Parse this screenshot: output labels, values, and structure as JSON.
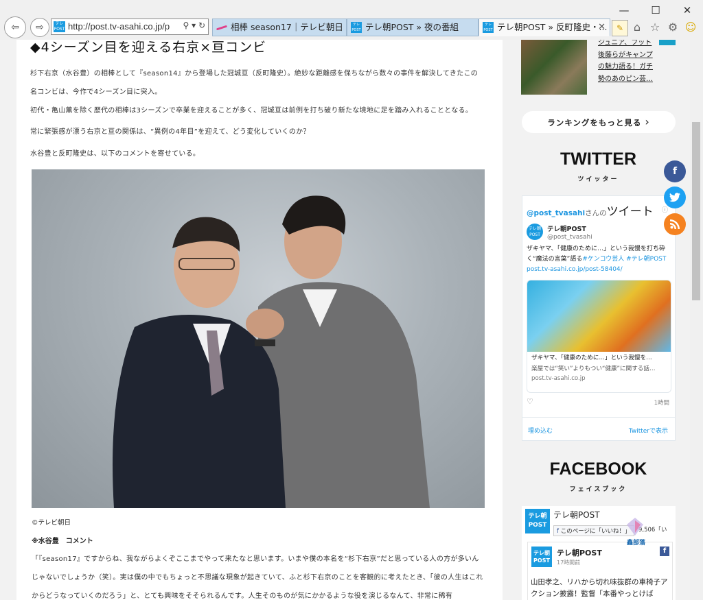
{
  "browser": {
    "url": "http://post.tv-asahi.co.jp/p",
    "favicon_text": "テレ朝POST",
    "tabs": [
      {
        "label": "相棒 season17｜テレビ朝日"
      },
      {
        "label": "テレ朝POST » 夜の番組"
      },
      {
        "label": "テレ朝POST » 反町隆史・..."
      }
    ],
    "window_controls": {
      "minimize": "—",
      "maximize": "☐",
      "close": "✕"
    }
  },
  "article": {
    "heading": "◆4シーズン目を迎える右京×亘コンビ",
    "paragraphs": [
      "杉下右京（水谷豊）の相棒として『season14』から登場した冠城亘（反町隆史）。絶妙な距離感を保ちながら数々の事件を解決してきたこの名コンビは、今作で4シーズン目に突入。",
      "初代・亀山薫を除く歴代の相棒は3シーズンで卒業を迎えることが多く、冠城亘は前例を打ち破り新たな境地に足を踏み入れることとなる。",
      "常に緊張感が漂う右京と亘の関係は、“異例の4年目”を迎えて、どう変化していくのか？",
      "水谷豊と反町隆史は、以下のコメントを寄せている。"
    ],
    "photo_caption": "©テレビ朝日",
    "comment_head": "※水谷豊　コメント",
    "comment_body": "「『season17』ですからね、我ながらよくぞここまでやって来たなと思います。いまや僕の本名を“杉下右京”だと思っている人の方が多いんじゃないでしょうか（笑）。実は僕の中でもちょっと不思議な現象が起きていて、ふと杉下右京のことを客観的に考えたとき、「彼の人生はこれからどうなっていくのだろう」と、とても興味をそそられるんです。人生そのものが気にかかるような役を演じるなんて、非常に稀有"
  },
  "sidebar": {
    "ranking_text_lines": [
      "ジュニア、フット",
      "後藤らがキャンプ",
      "の魅力語る！ガチ",
      "勢のあのピン芸…"
    ],
    "more_ranking": "ランキングをもっと見る",
    "twitter_title": "TWITTER",
    "twitter_sub": "ツイッター",
    "twitter_handle_head": "@post_tvasahi",
    "twitter_head_suffix": "さんの",
    "twitter_head_big": "ツイート",
    "tweet": {
      "name": "テレ朝POST",
      "handle": "@post_tvasahi",
      "text": "ザキヤマ、「健康のために…」という我慢を打ち砕く“魔法の言葉”語る",
      "hashtags": "#ケンコウ芸人 #テレ朝POST",
      "link": "post.tv-asahi.co.jp/post-58404/",
      "card_title": "ザキヤマ、「健康のために…」という我慢を…",
      "card_desc": "楽屋では“笑い”よりもつい“健康”に関する話…",
      "card_url": "post.tv-asahi.co.jp",
      "time": "1時間"
    },
    "embed_label": "埋め込む",
    "view_on_twitter": "Twitterで表示",
    "facebook_title": "FACEBOOK",
    "facebook_sub": "フェイスブック",
    "fb_page_name": "テレ朝POST",
    "fb_like_label": "このページに「いいね！」",
    "fb_like_count": "9,506「い",
    "fb_post_name": "テレ朝POST",
    "fb_post_time": "17時間前",
    "fb_post_text": "山田孝之、リハから切れ味抜群の車椅子アクション披露！監督「本番やっとけば",
    "watermark": "鑫部落"
  },
  "colors": {
    "twitter_blue": "#1b95e0",
    "facebook_blue": "#3b5998",
    "rss_orange": "#f58220",
    "brand_blue": "#1a9be0"
  }
}
